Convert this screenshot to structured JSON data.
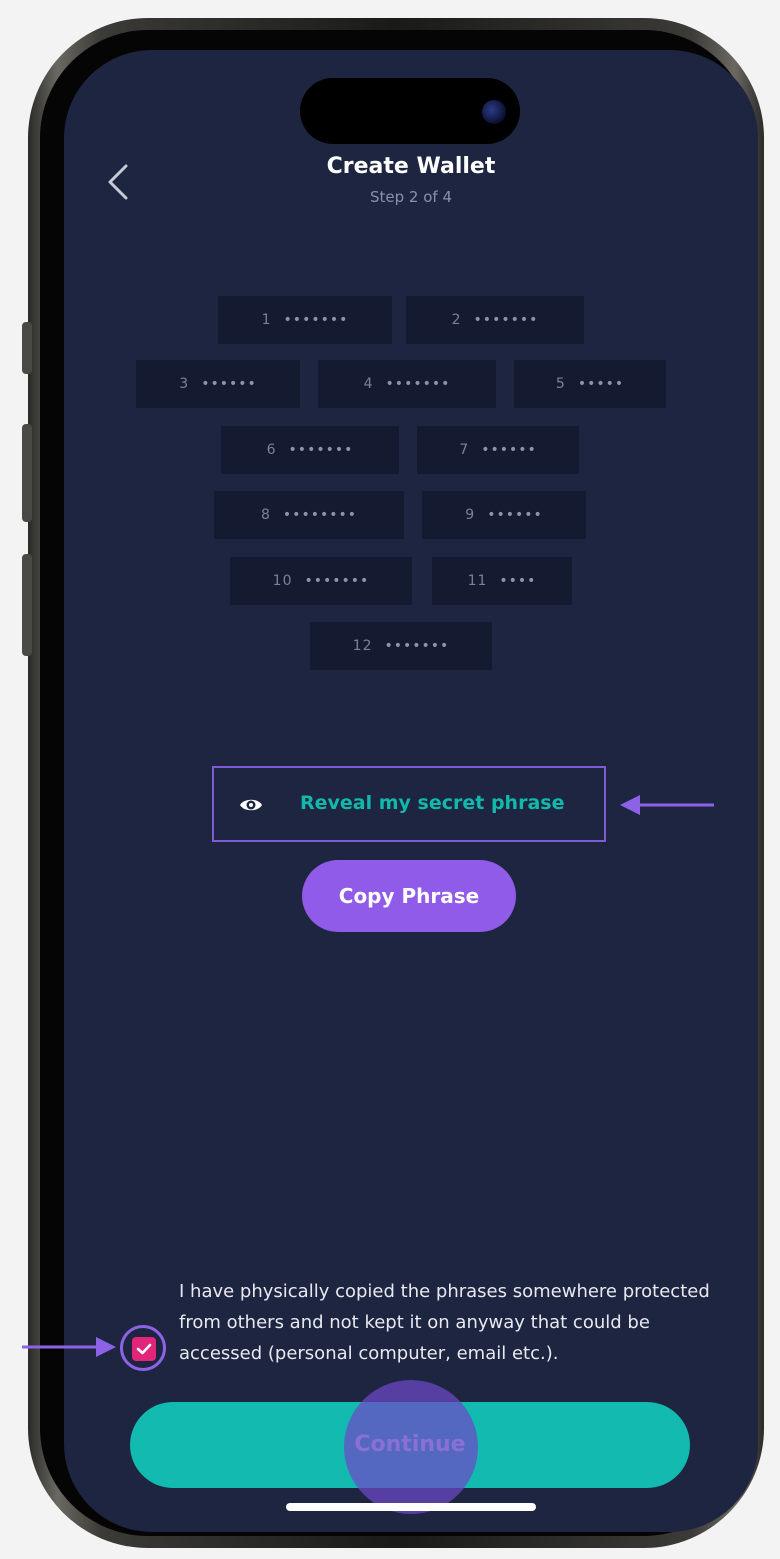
{
  "header": {
    "back_icon": "chevron-left-icon",
    "title": "Create Wallet",
    "subtitle": "Step 2 of 4"
  },
  "phrase": {
    "words": [
      {
        "num": "1",
        "mask": "•••••••"
      },
      {
        "num": "2",
        "mask": "•••••••"
      },
      {
        "num": "3",
        "mask": "••••••"
      },
      {
        "num": "4",
        "mask": "•••••••"
      },
      {
        "num": "5",
        "mask": "•••••"
      },
      {
        "num": "6",
        "mask": "•••••••"
      },
      {
        "num": "7",
        "mask": "••••••"
      },
      {
        "num": "8",
        "mask": "••••••••"
      },
      {
        "num": "9",
        "mask": "••••••"
      },
      {
        "num": "10",
        "mask": "•••••••"
      },
      {
        "num": "11",
        "mask": "••••"
      },
      {
        "num": "12",
        "mask": "•••••••"
      }
    ],
    "reveal_icon": "eye-icon",
    "reveal_label": "Reveal my secret phrase",
    "copy_label": "Copy Phrase"
  },
  "agreement": {
    "checked": true,
    "text": "I have physically copied the phrases somewhere protected from others and not kept it on anyway that could be accessed (personal computer, email etc.)."
  },
  "footer": {
    "continue_label": "Continue"
  },
  "colors": {
    "screen_bg": "#1d2540",
    "accent_teal": "#12bab0",
    "accent_purple": "#8f5be8",
    "checkbox_pink": "#e0257a",
    "annotation_arrow": "#8e62e6"
  }
}
